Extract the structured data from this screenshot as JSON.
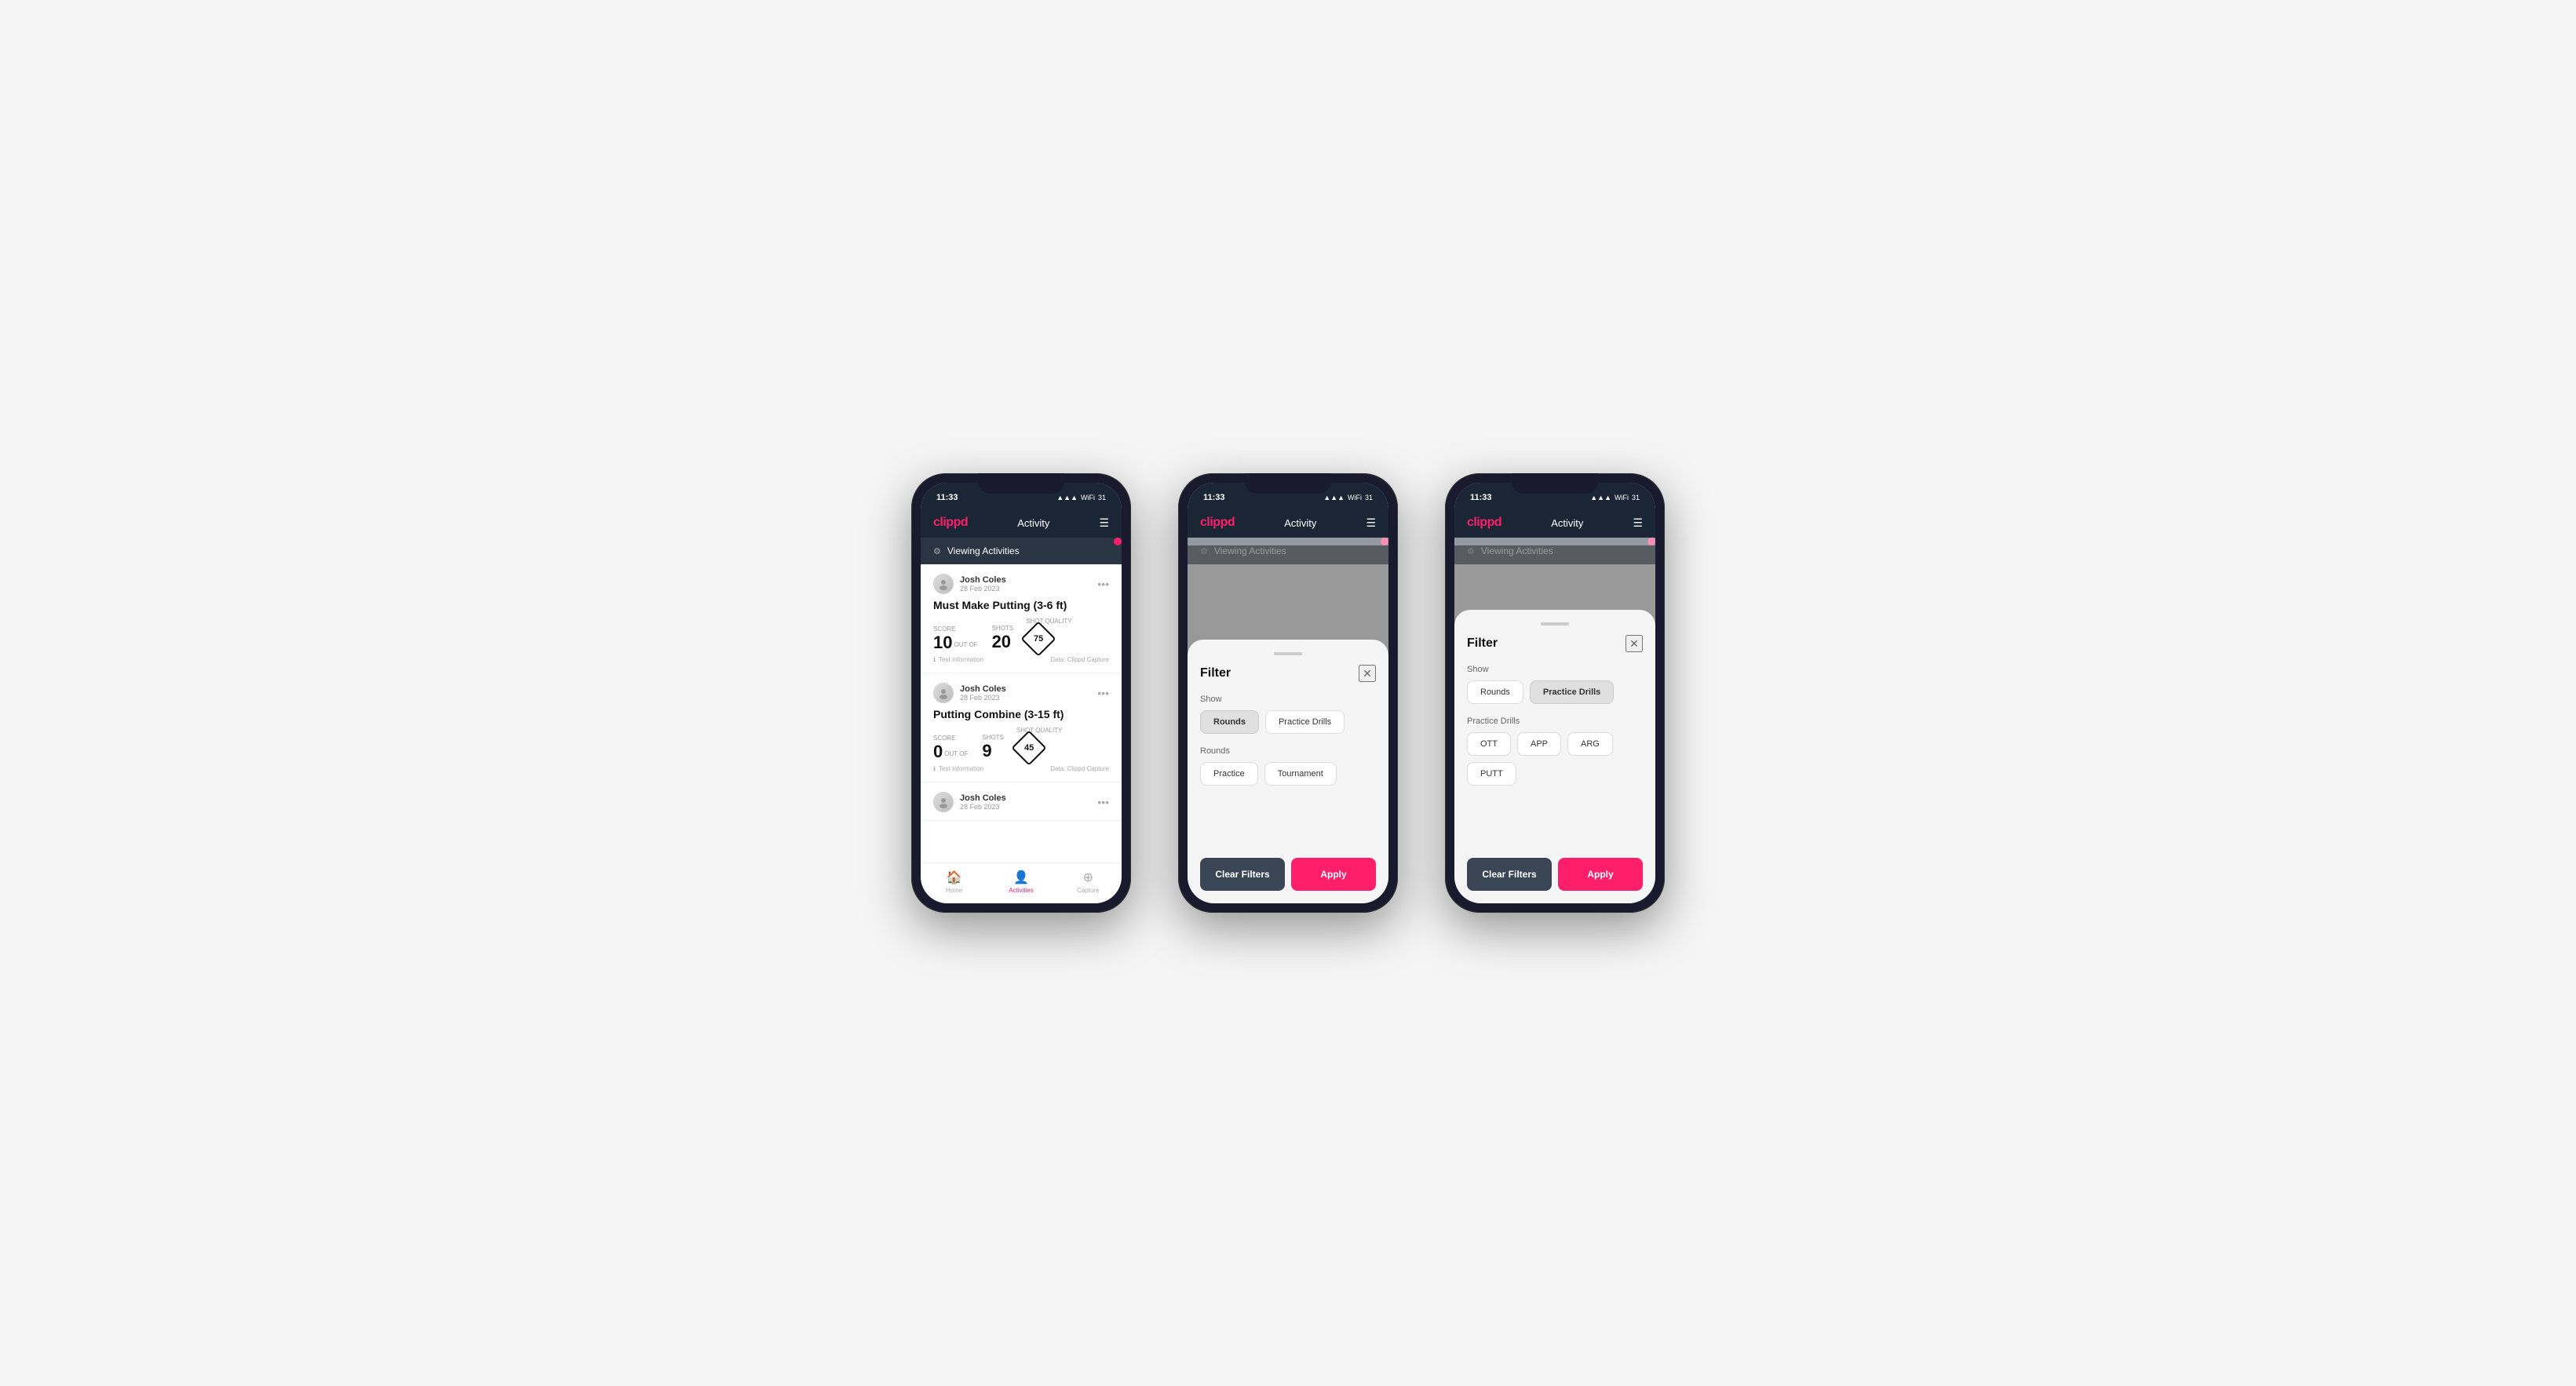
{
  "app": {
    "logo": "clippd",
    "header_title": "Activity",
    "time": "11:33",
    "signal": "▲▲▲",
    "wifi": "WiFi",
    "battery": "31"
  },
  "viewing_bar": {
    "text": "Viewing Activities",
    "icon": "⚙"
  },
  "cards": [
    {
      "user_name": "Josh Coles",
      "user_date": "28 Feb 2023",
      "title": "Must Make Putting (3-6 ft)",
      "score_label": "Score",
      "score_value": "10",
      "out_of": "OUT OF",
      "shots_label": "Shots",
      "shots_value": "20",
      "shot_quality_label": "Shot Quality",
      "shot_quality_value": "75",
      "info_text": "Test Information",
      "data_text": "Data: Clippd Capture"
    },
    {
      "user_name": "Josh Coles",
      "user_date": "28 Feb 2023",
      "title": "Putting Combine (3-15 ft)",
      "score_label": "Score",
      "score_value": "0",
      "out_of": "OUT OF",
      "shots_label": "Shots",
      "shots_value": "9",
      "shot_quality_label": "Shot Quality",
      "shot_quality_value": "45",
      "info_text": "Test Information",
      "data_text": "Data: Clippd Capture"
    },
    {
      "user_name": "Josh Coles",
      "user_date": "28 Feb 2023",
      "title": "",
      "score_label": "",
      "score_value": "",
      "out_of": "",
      "shots_label": "",
      "shots_value": "",
      "shot_quality_label": "",
      "shot_quality_value": "",
      "info_text": "",
      "data_text": ""
    }
  ],
  "nav": {
    "home_label": "Home",
    "activities_label": "Activities",
    "capture_label": "Capture"
  },
  "filter_modal_1": {
    "title": "Filter",
    "show_label": "Show",
    "rounds_btn": "Rounds",
    "practice_drills_btn": "Practice Drills",
    "rounds_section_label": "Rounds",
    "practice_btn": "Practice",
    "tournament_btn": "Tournament",
    "clear_filters_btn": "Clear Filters",
    "apply_btn": "Apply",
    "active_tab": "rounds"
  },
  "filter_modal_2": {
    "title": "Filter",
    "show_label": "Show",
    "rounds_btn": "Rounds",
    "practice_drills_btn": "Practice Drills",
    "practice_drills_section_label": "Practice Drills",
    "ott_btn": "OTT",
    "app_btn": "APP",
    "arg_btn": "ARG",
    "putt_btn": "PUTT",
    "clear_filters_btn": "Clear Filters",
    "apply_btn": "Apply",
    "active_tab": "practice_drills"
  }
}
